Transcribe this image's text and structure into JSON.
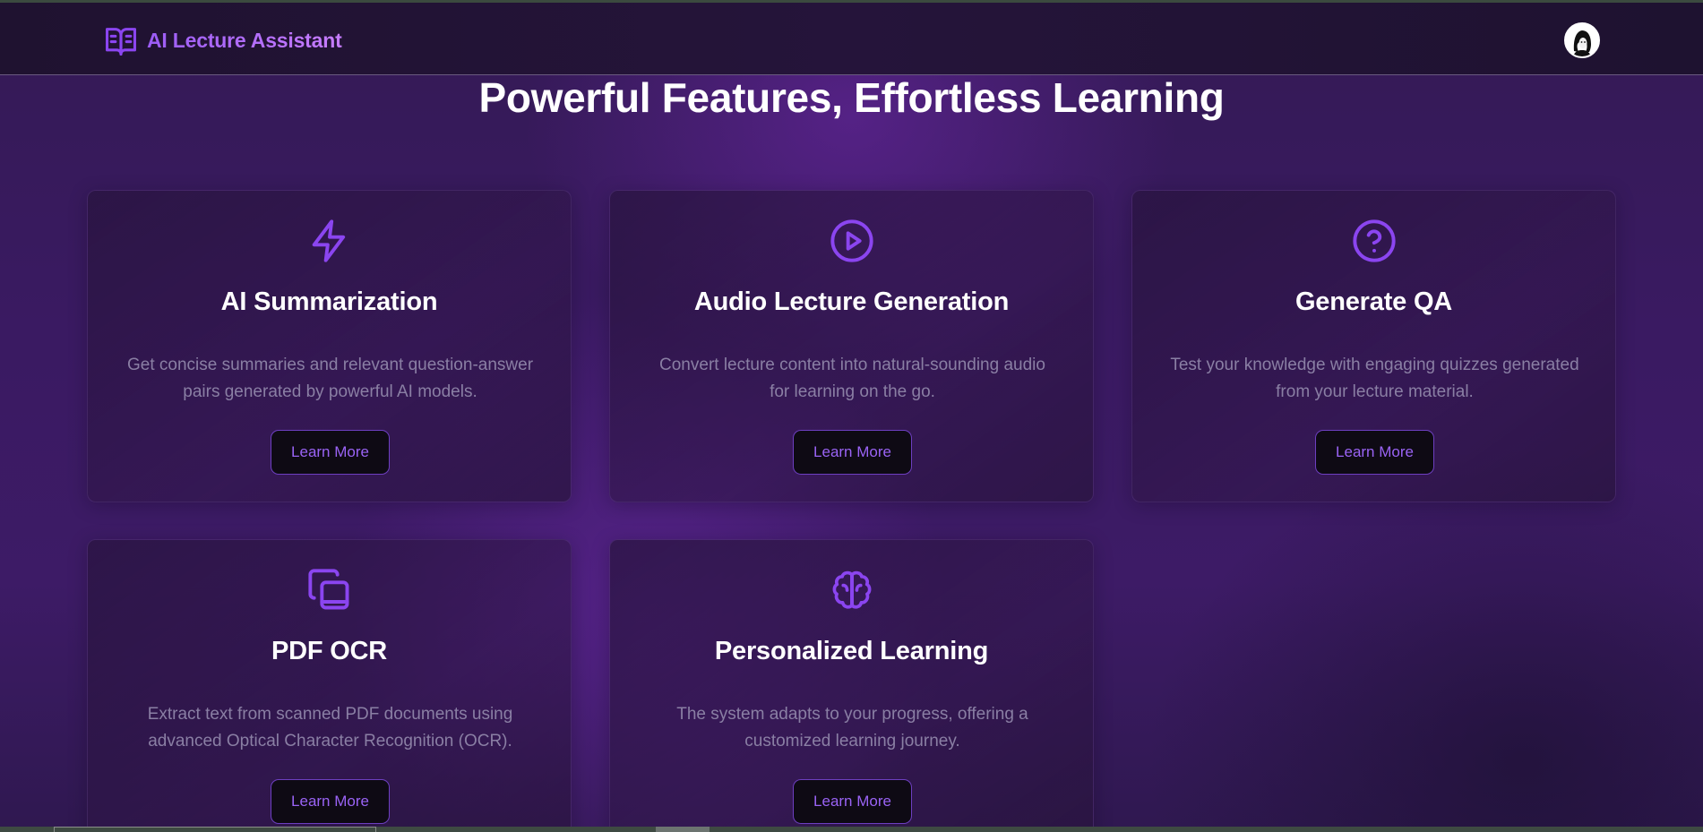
{
  "header": {
    "brand_name": "AI Lecture Assistant",
    "brand_icon": "book-open-icon",
    "avatar_icon": "user-avatar"
  },
  "main": {
    "title": "Powerful Features, Effortless Learning"
  },
  "colors": {
    "accent": "#8b45f0",
    "button_text": "#9a63f5",
    "description_text": "#8a7fa4",
    "background": "#3a1a62"
  },
  "features": [
    {
      "icon": "lightning-bolt-icon",
      "title": "AI Summarization",
      "desc_line1": "Get concise summaries and relevant question-answer",
      "desc_line2": "pairs generated by powerful AI models.",
      "button": "Learn More"
    },
    {
      "icon": "play-circle-icon",
      "title": "Audio Lecture Generation",
      "desc_line1": "Convert lecture content into natural-sounding audio",
      "desc_line2": "for learning on the go.",
      "button": "Learn More"
    },
    {
      "icon": "question-circle-icon",
      "title": "Generate QA",
      "desc_line1": "Test your knowledge with engaging quizzes generated",
      "desc_line2": "from your lecture material.",
      "button": "Learn More"
    },
    {
      "icon": "copy-documents-icon",
      "title": "PDF OCR",
      "desc_line1": "Extract text from scanned PDF documents using",
      "desc_line2": "advanced Optical Character Recognition (OCR).",
      "button": "Learn More"
    },
    {
      "icon": "brain-icon",
      "title": "Personalized Learning",
      "desc_line1": "The system adapts to your progress, offering a",
      "desc_line2": "customized learning journey.",
      "button": "Learn More"
    }
  ]
}
